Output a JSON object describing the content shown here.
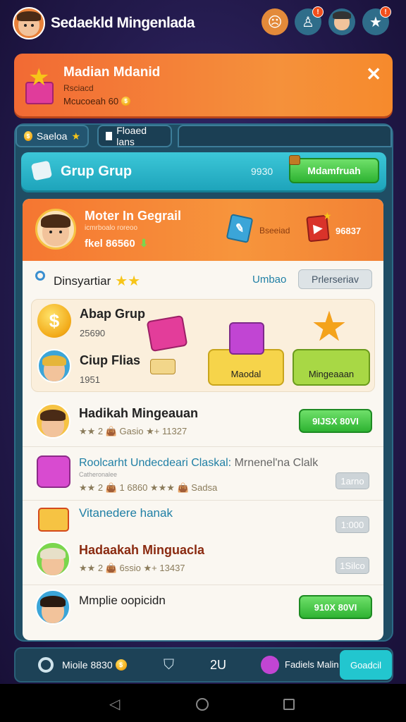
{
  "header": {
    "title": "Sedaekld Mingenlada"
  },
  "banner": {
    "title": "Madian Mdanid",
    "subtitle": "Rsciacd",
    "info": "Mcucoeah 60"
  },
  "tabs": [
    {
      "label": "Saeloa"
    },
    {
      "label": "Floaed lans"
    }
  ],
  "group_bar": {
    "title": "Grup Grup",
    "value": "9930",
    "button_label": "Mdamfruah"
  },
  "hero": {
    "name": "Moter In Gegrail",
    "sub": "icmrboalo roreoo",
    "stat": "fkel 86560",
    "book_label": "Bseeiad",
    "book_value": "96837"
  },
  "section": {
    "title": "Dinsyartiar",
    "link": "Umbao",
    "button": "Prlerseriav"
  },
  "card": {
    "item1_title": "Abap Grup",
    "item1_value": "25690",
    "item2_title": "Ciup Flias",
    "item2_value": "1951",
    "prize1_label": "Maodal",
    "prize2_label": "Mingeaaan"
  },
  "list": [
    {
      "title": "Hadikah Mingeauan",
      "meta": "★★ 2 👜 Gasio ★+ 11327",
      "button": "9IJSX 80VI",
      "btn_type": "green"
    },
    {
      "title": "Roolcarht Undecdeari Claskal:",
      "title2": "Mrnenel'na Clalk",
      "sub": "Catheronalee",
      "meta": "★★ 2 👜 1 6860 ★★★ 👜 Sadsa",
      "button": "1arno",
      "btn_type": "gray"
    },
    {
      "title": "Vitanedere hanak",
      "button": "1:000",
      "btn_type": "gray"
    },
    {
      "title": "Hadaakah Minguacla",
      "meta": "★★ 2 👜 6ssio ★+ 13437",
      "button": "1Silco",
      "btn_type": "gray"
    },
    {
      "title": "Mmplie oopicidn",
      "button": "910X 80VI",
      "btn_type": "green"
    }
  ],
  "bottom": {
    "left": "Mioile 8830",
    "center": "2U",
    "right_label": "Fadiels Malin",
    "button": "Goadcil"
  },
  "colors": {
    "accent_orange": "#f5913b",
    "teal": "#1ea4bb",
    "green": "#2eb332"
  }
}
